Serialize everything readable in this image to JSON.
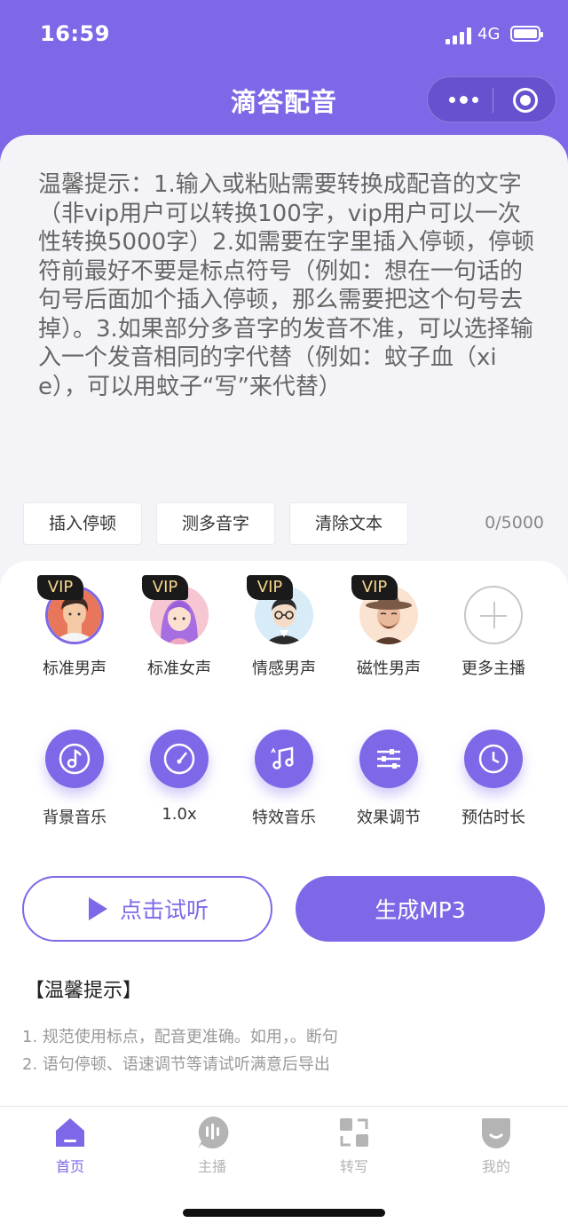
{
  "status_bar": {
    "time": "16:59",
    "network": "4G"
  },
  "nav": {
    "title": "滴答配音"
  },
  "notice": {
    "text": "温馨提示：1.输入或粘贴需要转换成配音的文字（非vip用户可以转换100字，vip用户可以一次性转换5000字）2.如需要在字里插入停顿，停顿符前最好不要是标点符号（例如：想在一句话的句号后面加个插入停顿，那么需要把这个句号去掉）。3.如果部分多音字的发音不准，可以选择输入一个发音相同的字代替（例如：蚊子血（xie），可以用蚊子“写”来代替）"
  },
  "tools": {
    "insert_pause": "插入停顿",
    "polyphone": "测多音字",
    "clear": "清除文本",
    "counter": "0/5000"
  },
  "voices": [
    {
      "label": "标准男声",
      "badge": "VIP"
    },
    {
      "label": "标准女声",
      "badge": "VIP"
    },
    {
      "label": "情感男声",
      "badge": "VIP"
    },
    {
      "label": "磁性男声",
      "badge": "VIP"
    },
    {
      "label": "更多主播"
    }
  ],
  "functions": [
    {
      "label": "背景音乐",
      "icon": "music-note-icon"
    },
    {
      "label": "1.0x",
      "icon": "speed-gauge-icon"
    },
    {
      "label": "特效音乐",
      "icon": "music-notes-icon"
    },
    {
      "label": "效果调节",
      "icon": "sliders-icon"
    },
    {
      "label": "预估时长",
      "icon": "clock-icon"
    }
  ],
  "actions": {
    "preview": "点击试听",
    "generate": "生成MP3"
  },
  "tips": {
    "title": "【温馨提示】",
    "items": [
      "1. 规范使用标点，配音更准确。如用，。断句",
      "2. 语句停顿、语速调节等请试听满意后导出"
    ]
  },
  "tabbar": [
    {
      "label": "首页",
      "icon": "home-icon",
      "active": true
    },
    {
      "label": "主播",
      "icon": "anchor-mic-icon"
    },
    {
      "label": "转写",
      "icon": "transcribe-icon"
    },
    {
      "label": "我的",
      "icon": "profile-icon"
    }
  ],
  "colors": {
    "accent": "#7f68e8",
    "vip_text": "#f7d58b"
  }
}
